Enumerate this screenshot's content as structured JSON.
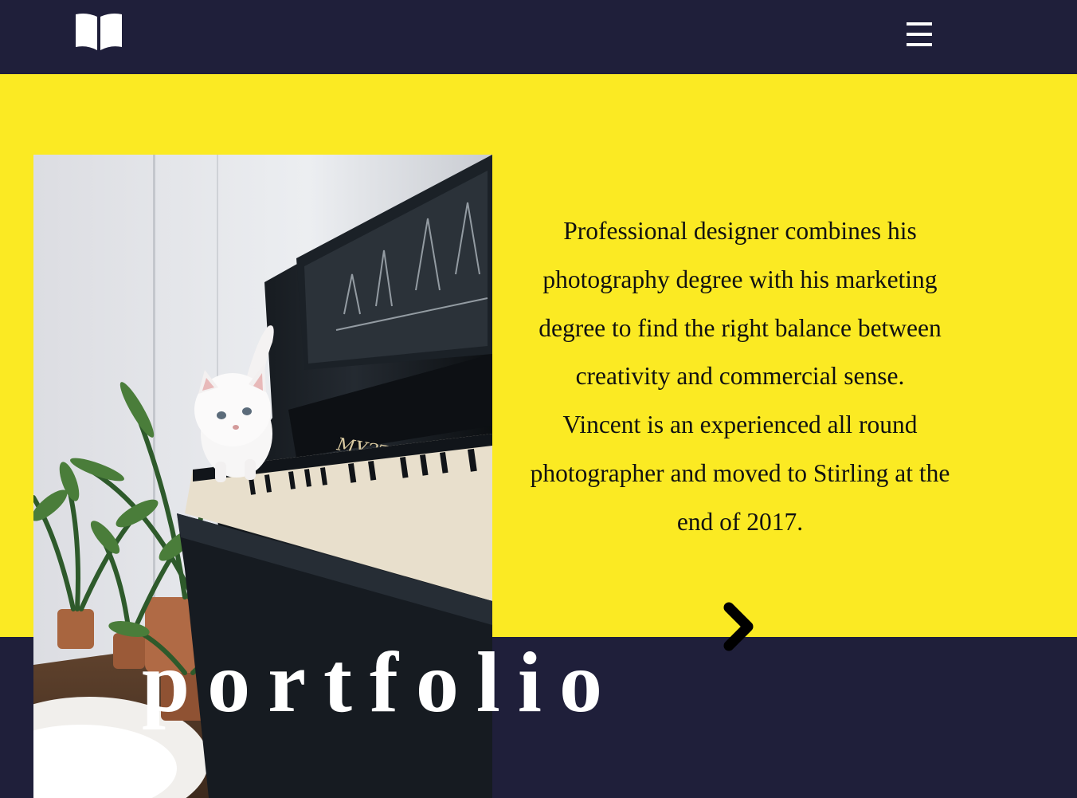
{
  "header": {
    "logo_icon": "open-book-icon",
    "menu_icon": "hamburger-menu-icon"
  },
  "hero": {
    "background_color": "#fbea23",
    "image": "cat-walking-on-piano-keys-photo",
    "bio_paragraph_1": "Professional designer combines his photography degree with his marketing degree to find the right balance between creativity and commercial sense.",
    "bio_paragraph_2": "Vincent is an experienced all round photographer and moved to Stirling at the end of 2017.",
    "next_icon": "chevron-right-icon"
  },
  "footer": {
    "background_color": "#1f1f3a",
    "title": "portfolio"
  }
}
